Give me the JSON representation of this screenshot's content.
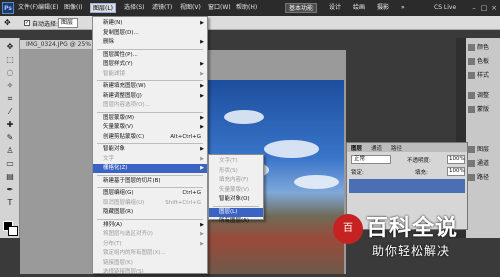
{
  "menubar": {
    "logo": "Ps",
    "items": [
      "文件(F)",
      "编辑(E)",
      "图像(I)",
      "图层(L)",
      "选择(S)",
      "滤镜(T)",
      "视图(V)",
      "窗口(W)",
      "帮助(H)"
    ],
    "zoom": "25%",
    "workspaces": [
      "基本功能",
      "设计",
      "绘画",
      "摄影"
    ],
    "overflow": "»",
    "cslive": "CS Live",
    "window_controls": [
      "–",
      "□",
      "×"
    ]
  },
  "options": {
    "auto_select_label": "自动选择:",
    "auto_select_value": "图层"
  },
  "document": {
    "tab_title": "IMG_0324.JPG @ 25% (RGB/8)"
  },
  "layer_menu": {
    "items": [
      {
        "label": "新建(N)",
        "disabled": false,
        "submenu": true
      },
      {
        "label": "复制图层(D)...",
        "disabled": false
      },
      {
        "label": "删除",
        "disabled": false,
        "submenu": true
      },
      {
        "label": "图层属性(P)...",
        "disabled": false
      },
      {
        "label": "图层样式(Y)",
        "disabled": false,
        "submenu": true
      },
      {
        "label": "智能滤镜",
        "disabled": true,
        "submenu": true
      },
      {
        "label": "新建填充图层(W)",
        "disabled": false,
        "submenu": true
      },
      {
        "label": "新建调整图层(J)",
        "disabled": false,
        "submenu": true
      },
      {
        "label": "图层内容选项(O)...",
        "disabled": true
      },
      {
        "label": "图层蒙版(M)",
        "disabled": false,
        "submenu": true
      },
      {
        "label": "矢量蒙版(V)",
        "disabled": false,
        "submenu": true
      },
      {
        "label": "创建剪贴蒙版(C)",
        "disabled": false,
        "shortcut": "Alt+Ctrl+G"
      },
      {
        "label": "智能对象",
        "disabled": false,
        "submenu": true
      },
      {
        "label": "文字",
        "disabled": true,
        "submenu": true
      },
      {
        "label": "栅格化(Z)",
        "disabled": false,
        "submenu": true,
        "highlighted": true
      },
      {
        "label": "新建基于图层的切片(B)",
        "disabled": false
      },
      {
        "label": "图层编组(G)",
        "disabled": false,
        "shortcut": "Ctrl+G"
      },
      {
        "label": "取消图层编组(U)",
        "disabled": true,
        "shortcut": "Shift+Ctrl+G"
      },
      {
        "label": "隐藏图层(R)",
        "disabled": false
      },
      {
        "label": "排列(A)",
        "disabled": false,
        "submenu": true
      },
      {
        "label": "将图层与选区对齐(I)",
        "disabled": true,
        "submenu": true
      },
      {
        "label": "分布(T)",
        "disabled": true,
        "submenu": true
      },
      {
        "label": "锁定组内的所有图层(X)...",
        "disabled": true
      },
      {
        "label": "链接图层(K)",
        "disabled": true
      },
      {
        "label": "选择链接图层(S)",
        "disabled": true
      }
    ]
  },
  "rasterize_menu": {
    "items": [
      {
        "label": "文字(T)",
        "disabled": true
      },
      {
        "label": "形状(S)",
        "disabled": true
      },
      {
        "label": "填充内容(F)",
        "disabled": true
      },
      {
        "label": "矢量蒙版(V)",
        "disabled": true
      },
      {
        "label": "智能对象(O)",
        "disabled": false
      },
      {
        "label": "图层(L)",
        "disabled": false,
        "highlighted": true
      },
      {
        "label": "所有图层(A)",
        "disabled": false
      }
    ]
  },
  "right_panel": {
    "items": [
      "颜色",
      "色板",
      "样式",
      "调整",
      "蒙版",
      "图层",
      "通道",
      "路径"
    ]
  },
  "layers_panel": {
    "tabs": [
      "图层",
      "通道",
      "路径"
    ],
    "blend_mode": "正常",
    "opacity_label": "不透明度:",
    "opacity_value": "100%",
    "lock_label": "锁定:",
    "fill_label": "填充:",
    "fill_value": "100%"
  },
  "watermark": {
    "icon_text": "百",
    "title": "百科全说",
    "subtitle": "助你轻松解决"
  }
}
